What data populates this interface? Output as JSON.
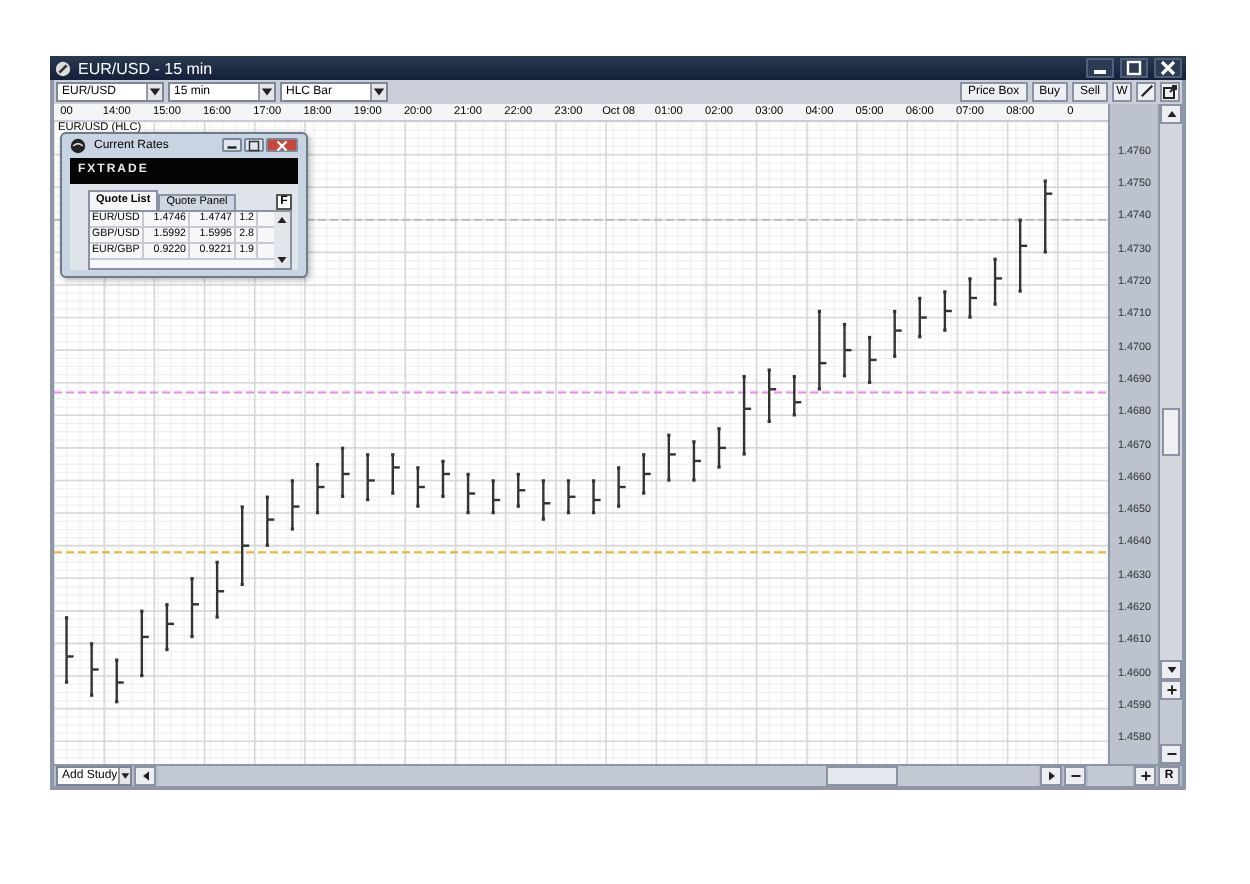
{
  "window": {
    "title": "EUR/USD - 15 min"
  },
  "toolbar": {
    "dropdowns": [
      "EUR/USD",
      "15 min",
      "HLC Bar"
    ],
    "buttons": [
      "Price Box",
      "Buy",
      "Sell"
    ],
    "tool_buttons": [
      "W"
    ]
  },
  "chart": {
    "label": "EUR/USD (HLC)",
    "chart_data": {
      "type": "scatter",
      "ylim": [
        1.4573,
        1.477
      ],
      "categories": [
        "00",
        null,
        "14:00",
        null,
        "15:00",
        null,
        "16:00",
        null,
        "17:00",
        null,
        "18:00",
        null,
        "19:00",
        null,
        "20:00",
        null,
        "21:00",
        null,
        "22:00",
        null,
        "23:00",
        null,
        "Oct 08",
        null,
        "01:00",
        null,
        "02:00",
        null,
        "03:00",
        null,
        "04:00",
        null,
        "05:00",
        null,
        "06:00",
        null,
        "07:00",
        null,
        "08:00",
        null,
        "0",
        null
      ],
      "yticks": [
        {
          "value": 1.476,
          "label": "1.4760"
        },
        {
          "value": 1.475,
          "label": "1.4750"
        },
        {
          "value": 1.474,
          "label": "1.4740"
        },
        {
          "value": 1.473,
          "label": "1.4730"
        },
        {
          "value": 1.472,
          "label": "1.4720"
        },
        {
          "value": 1.471,
          "label": "1.4710"
        },
        {
          "value": 1.47,
          "label": "1.4700"
        },
        {
          "value": 1.469,
          "label": "1.4690"
        },
        {
          "value": 1.468,
          "label": "1.4680"
        },
        {
          "value": 1.467,
          "label": "1.4670"
        },
        {
          "value": 1.466,
          "label": "1.4660"
        },
        {
          "value": 1.465,
          "label": "1.4650"
        },
        {
          "value": 1.464,
          "label": "1.4640"
        },
        {
          "value": 1.463,
          "label": "1.4630"
        },
        {
          "value": 1.462,
          "label": "1.4620"
        },
        {
          "value": 1.461,
          "label": "1.4610"
        },
        {
          "value": 1.46,
          "label": "1.4600"
        },
        {
          "value": 1.459,
          "label": "1.4590"
        },
        {
          "value": 1.458,
          "label": "1.4580"
        }
      ],
      "series": [
        {
          "color": "#333333",
          "values": [
            1.4618,
            1.461,
            1.4605,
            1.462,
            1.4622,
            1.463,
            1.4635,
            1.4652,
            1.4655,
            1.466,
            1.4665,
            1.467,
            1.4668,
            1.4668,
            1.4664,
            1.4666,
            1.4662,
            1.466,
            1.4662,
            1.466,
            1.466,
            1.466,
            1.4664,
            1.4668,
            1.4674,
            1.4672,
            1.4676,
            1.4692,
            1.4694,
            1.4692,
            1.4712,
            1.4708,
            1.4704,
            1.4712,
            1.4716,
            1.4718,
            1.4722,
            1.4728,
            1.474,
            1.4752,
            null,
            null
          ]
        },
        {
          "color": "#333333",
          "values": [
            1.4598,
            1.4594,
            1.4592,
            1.46,
            1.4608,
            1.4612,
            1.4618,
            1.4628,
            1.464,
            1.4645,
            1.465,
            1.4655,
            1.4654,
            1.4656,
            1.4652,
            1.4655,
            1.465,
            1.465,
            1.4652,
            1.4648,
            1.465,
            1.465,
            1.4652,
            1.4656,
            1.466,
            1.466,
            1.4664,
            1.4668,
            1.4678,
            1.468,
            1.4688,
            1.4692,
            1.469,
            1.4698,
            1.4704,
            1.4706,
            1.471,
            1.4714,
            1.4718,
            1.473,
            null,
            null
          ]
        },
        {
          "color": "#333333",
          "values": [
            1.4606,
            1.4602,
            1.4598,
            1.4612,
            1.4616,
            1.4622,
            1.4626,
            1.464,
            1.4648,
            1.4652,
            1.4658,
            1.4662,
            1.466,
            1.4664,
            1.4658,
            1.4662,
            1.4656,
            1.4654,
            1.4657,
            1.4653,
            1.4655,
            1.4654,
            1.4658,
            1.4662,
            1.4668,
            1.4666,
            1.467,
            1.4682,
            1.4688,
            1.4684,
            1.4696,
            1.47,
            1.4697,
            1.4706,
            1.471,
            1.4712,
            1.4716,
            1.4722,
            1.4732,
            1.4748,
            null,
            null
          ]
        }
      ],
      "grid": true,
      "ref_lines": [
        {
          "axis": "y",
          "value": 1.474,
          "color": "#bbbbbb"
        },
        {
          "axis": "y",
          "value": 1.4687,
          "color": "#ee88ee"
        },
        {
          "axis": "y",
          "value": 1.4638,
          "color": "#f0b030"
        }
      ]
    }
  },
  "rates_window": {
    "title": "Current Rates",
    "banner": "FXTRADE",
    "tabs": [
      {
        "label": "Quote List",
        "selected": true
      },
      {
        "label": "Quote Panel",
        "selected": false
      }
    ],
    "corner_button": "F",
    "rows": [
      {
        "pair": "EUR/USD",
        "bid": "1.4746",
        "ask": "1.4747",
        "spread": "1.2"
      },
      {
        "pair": "GBP/USD",
        "bid": "1.5992",
        "ask": "1.5995",
        "spread": "2.8"
      },
      {
        "pair": "EUR/GBP",
        "bid": "0.9220",
        "ask": "0.9221",
        "spread": "1.9"
      }
    ]
  },
  "bottom_bar": {
    "study_dropdown": "Add Study",
    "reset_button": "R"
  }
}
